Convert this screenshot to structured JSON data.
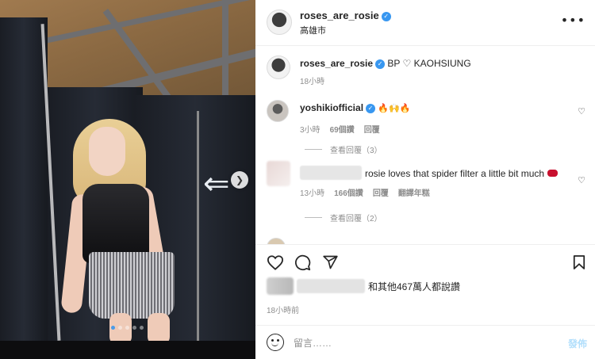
{
  "post": {
    "author": "roses_are_rosie",
    "location": "高雄市",
    "carousel_dots": 5,
    "carousel_active": 1
  },
  "caption": {
    "author": "roses_are_rosie",
    "text": "BP ♡ KAOHSIUNG",
    "time": "18小時"
  },
  "comments": [
    {
      "author": "yoshikiofficial",
      "emoji": "🔥🙌🔥",
      "time": "3小時",
      "likes": "69個讚",
      "reply": "回覆",
      "view_replies": "查看回覆（3）"
    },
    {
      "text": "rosie loves that spider filter a little bit much",
      "time": "13小時",
      "likes": "166個讚",
      "reply": "回覆",
      "translate": "翻譯年糕",
      "view_replies": "查看回覆（2）"
    }
  ],
  "likes_summary": "和其他467萬人都說讚",
  "post_time": "18小時前",
  "composer": {
    "placeholder": "留言……",
    "post_label": "發佈"
  },
  "icons": {
    "more": "more-icon",
    "heart": "heart-icon",
    "comment": "comment-icon",
    "share": "share-icon",
    "save": "bookmark-icon",
    "emoji": "emoji-icon",
    "next": "chevron-right-icon"
  },
  "colors": {
    "verified": "#3897f0",
    "muted": "#8e8e8e",
    "post_button": "#b2dffc"
  }
}
